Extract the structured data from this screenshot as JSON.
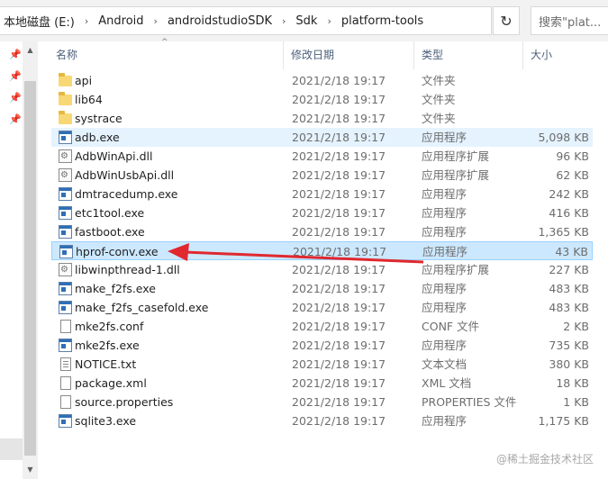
{
  "address_bar": {
    "crumbs": [
      "本地磁盘 (E:)",
      "Android",
      "androidstudioSDK",
      "Sdk",
      "platform-tools"
    ]
  },
  "search": {
    "placeholder": "搜索\"plat..."
  },
  "columns": {
    "name": "名称",
    "date": "修改日期",
    "type": "类型",
    "size": "大小"
  },
  "files": [
    {
      "name": "api",
      "date": "2021/2/18 19:17",
      "type": "文件夹",
      "size": "",
      "icon": "folder-icon"
    },
    {
      "name": "lib64",
      "date": "2021/2/18 19:17",
      "type": "文件夹",
      "size": "",
      "icon": "folder-icon"
    },
    {
      "name": "systrace",
      "date": "2021/2/18 19:17",
      "type": "文件夹",
      "size": "",
      "icon": "folder-icon"
    },
    {
      "name": "adb.exe",
      "date": "2021/2/18 19:17",
      "type": "应用程序",
      "size": "5,098 KB",
      "icon": "exe-icon"
    },
    {
      "name": "AdbWinApi.dll",
      "date": "2021/2/18 19:17",
      "type": "应用程序扩展",
      "size": "96 KB",
      "icon": "dll-icon"
    },
    {
      "name": "AdbWinUsbApi.dll",
      "date": "2021/2/18 19:17",
      "type": "应用程序扩展",
      "size": "62 KB",
      "icon": "dll-icon"
    },
    {
      "name": "dmtracedump.exe",
      "date": "2021/2/18 19:17",
      "type": "应用程序",
      "size": "242 KB",
      "icon": "exe-icon"
    },
    {
      "name": "etc1tool.exe",
      "date": "2021/2/18 19:17",
      "type": "应用程序",
      "size": "416 KB",
      "icon": "exe-icon"
    },
    {
      "name": "fastboot.exe",
      "date": "2021/2/18 19:17",
      "type": "应用程序",
      "size": "1,365 KB",
      "icon": "exe-icon"
    },
    {
      "name": "hprof-conv.exe",
      "date": "2021/2/18 19:17",
      "type": "应用程序",
      "size": "43 KB",
      "icon": "exe-icon"
    },
    {
      "name": "libwinpthread-1.dll",
      "date": "2021/2/18 19:17",
      "type": "应用程序扩展",
      "size": "227 KB",
      "icon": "dll-icon"
    },
    {
      "name": "make_f2fs.exe",
      "date": "2021/2/18 19:17",
      "type": "应用程序",
      "size": "483 KB",
      "icon": "exe-icon"
    },
    {
      "name": "make_f2fs_casefold.exe",
      "date": "2021/2/18 19:17",
      "type": "应用程序",
      "size": "483 KB",
      "icon": "exe-icon"
    },
    {
      "name": "mke2fs.conf",
      "date": "2021/2/18 19:17",
      "type": "CONF 文件",
      "size": "2 KB",
      "icon": "file-icon"
    },
    {
      "name": "mke2fs.exe",
      "date": "2021/2/18 19:17",
      "type": "应用程序",
      "size": "735 KB",
      "icon": "exe-icon"
    },
    {
      "name": "NOTICE.txt",
      "date": "2021/2/18 19:17",
      "type": "文本文档",
      "size": "380 KB",
      "icon": "text-file-icon"
    },
    {
      "name": "package.xml",
      "date": "2021/2/18 19:17",
      "type": "XML 文档",
      "size": "18 KB",
      "icon": "file-icon"
    },
    {
      "name": "source.properties",
      "date": "2021/2/18 19:17",
      "type": "PROPERTIES 文件",
      "size": "1 KB",
      "icon": "file-icon"
    },
    {
      "name": "sqlite3.exe",
      "date": "2021/2/18 19:17",
      "type": "应用程序",
      "size": "1,175 KB",
      "icon": "exe-icon"
    }
  ],
  "highlighted_row": 3,
  "selected_row": 9,
  "annotation_color": "#e0282e",
  "watermark": "@稀土掘金技术社区"
}
